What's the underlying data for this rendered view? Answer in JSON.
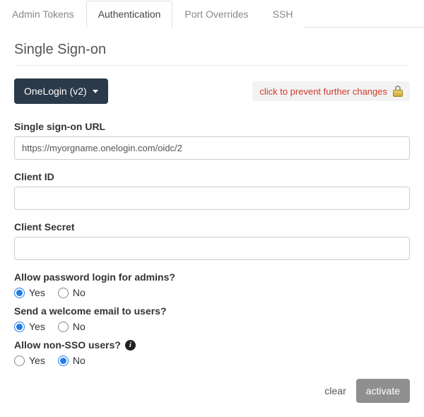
{
  "tabs": {
    "items": [
      {
        "label": "Admin Tokens",
        "active": false
      },
      {
        "label": "Authentication",
        "active": true
      },
      {
        "label": "Port Overrides",
        "active": false
      },
      {
        "label": "SSH",
        "active": false
      }
    ]
  },
  "section": {
    "title": "Single Sign-on"
  },
  "provider_dropdown": {
    "label": "OneLogin (v2)"
  },
  "lock_notice": {
    "text": "click to prevent further changes"
  },
  "fields": {
    "sso_url": {
      "label": "Single sign-on URL",
      "value": "https://myorgname.onelogin.com/oidc/2"
    },
    "client_id": {
      "label": "Client ID",
      "value": ""
    },
    "client_secret": {
      "label": "Client Secret",
      "value": ""
    }
  },
  "questions": {
    "allow_password_admins": {
      "label": "Allow password login for admins?",
      "yes": "Yes",
      "no": "No",
      "selected": "yes"
    },
    "send_welcome_email": {
      "label": "Send a welcome email to users?",
      "yes": "Yes",
      "no": "No",
      "selected": "yes"
    },
    "allow_non_sso_users": {
      "label": "Allow non-SSO users?",
      "yes": "Yes",
      "no": "No",
      "selected": "no"
    }
  },
  "footer": {
    "clear": "clear",
    "activate": "activate"
  }
}
